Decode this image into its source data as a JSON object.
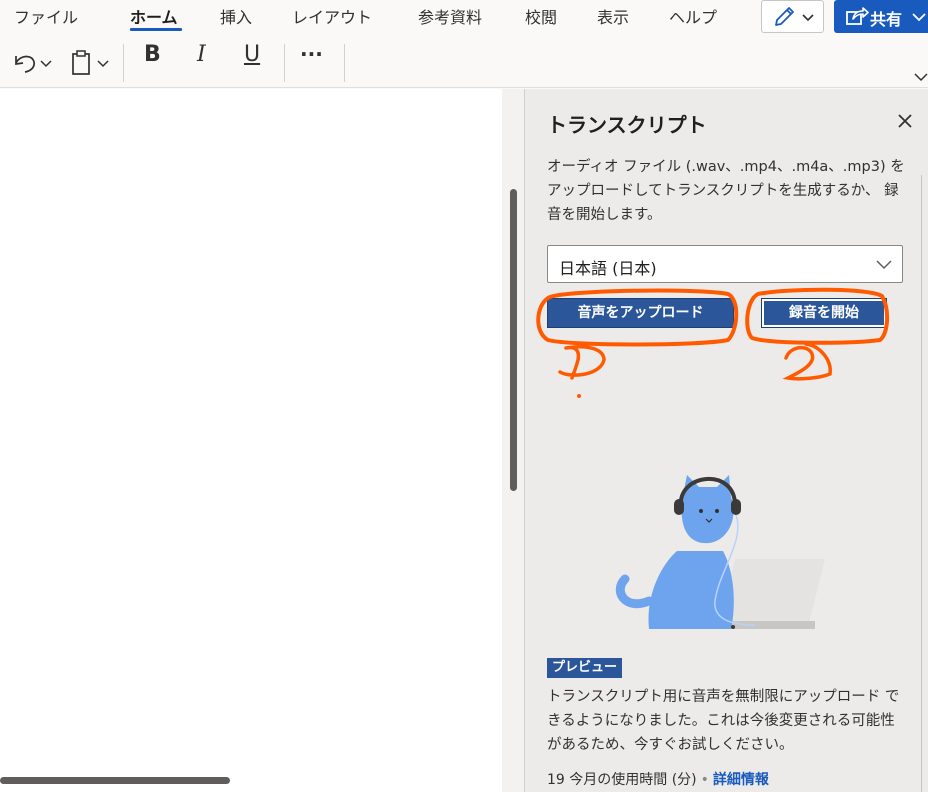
{
  "menu": {
    "items": [
      "ファイル",
      "ホーム",
      "挿入",
      "レイアウト",
      "参考資料",
      "校閲",
      "表示",
      "ヘルプ"
    ],
    "active": "ホーム",
    "share_label": "共有"
  },
  "toolbar": {
    "bold_label": "B",
    "italic_label": "I",
    "underline_label": "U",
    "more_label": "···"
  },
  "panel": {
    "title": "トランスクリプト",
    "description": "オーディオ ファイル (.wav、.mp4、.m4a、.mp3) を アップロードしてトランスクリプトを生成するか、 録音を開始します。",
    "language_value": "日本語 (日本)",
    "upload_button": "音声をアップロード",
    "record_button": "録音を開始",
    "preview_badge": "プレビュー",
    "preview_text": "トランスクリプト用に音声を無制限にアップロード できるようになりました。これは今後変更される可能性があるため、今すぐお試しください。",
    "usage_text": "19 今月の使用時間 (分)",
    "usage_separator": "•",
    "details_link": "詳細情報"
  },
  "colors": {
    "accent": "#185abd",
    "button_blue": "#2b579a",
    "annotation": "#ff5a00",
    "panel_bg": "#edebe9"
  },
  "annotations": [
    "1",
    "2"
  ]
}
